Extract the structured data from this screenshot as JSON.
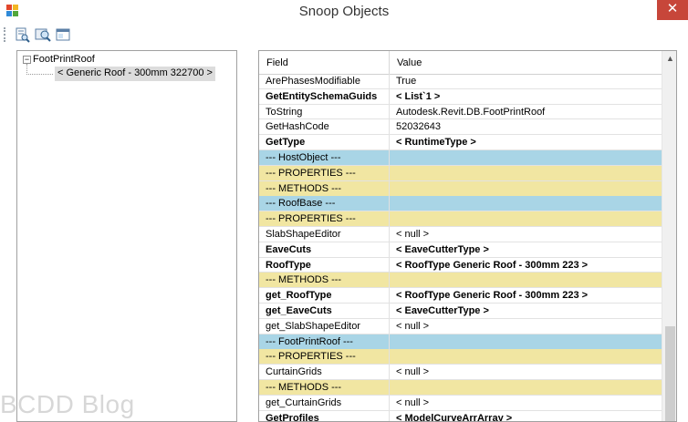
{
  "window": {
    "title": "Snoop Objects",
    "close_glyph": "✕"
  },
  "toolbar": {
    "buttons": [
      "snoop-icon",
      "find-icon",
      "window-icon"
    ]
  },
  "tree": {
    "expander_glyph": "−",
    "root_label": "FootPrintRoof",
    "child_label": "< Generic Roof - 300mm  322700 >"
  },
  "grid": {
    "columns": {
      "field": "Field",
      "value": "Value"
    },
    "rows": [
      {
        "field": "ArePhasesModifiable",
        "value": "True",
        "style": "normal"
      },
      {
        "field": "GetEntitySchemaGuids",
        "value": "< List`1 >",
        "style": "bold"
      },
      {
        "field": "ToString",
        "value": "Autodesk.Revit.DB.FootPrintRoof",
        "style": "normal"
      },
      {
        "field": "GetHashCode",
        "value": "52032643",
        "style": "normal"
      },
      {
        "field": "GetType",
        "value": "< RuntimeType >",
        "style": "bold"
      },
      {
        "field": "--- HostObject ---",
        "value": "",
        "style": "class"
      },
      {
        "field": "--- PROPERTIES ---",
        "value": "",
        "style": "section"
      },
      {
        "field": "--- METHODS ---",
        "value": "",
        "style": "section"
      },
      {
        "field": "--- RoofBase ---",
        "value": "",
        "style": "class"
      },
      {
        "field": "--- PROPERTIES ---",
        "value": "",
        "style": "section"
      },
      {
        "field": "SlabShapeEditor",
        "value": "< null >",
        "style": "normal"
      },
      {
        "field": "EaveCuts",
        "value": "< EaveCutterType >",
        "style": "bold"
      },
      {
        "field": "RoofType",
        "value": "< RoofType  Generic Roof - 300mm    223 >",
        "style": "bold"
      },
      {
        "field": "--- METHODS ---",
        "value": "",
        "style": "section"
      },
      {
        "field": "get_RoofType",
        "value": "< RoofType  Generic Roof - 300mm    223 >",
        "style": "bold"
      },
      {
        "field": "get_EaveCuts",
        "value": "< EaveCutterType >",
        "style": "bold"
      },
      {
        "field": "get_SlabShapeEditor",
        "value": "< null >",
        "style": "normal"
      },
      {
        "field": "--- FootPrintRoof ---",
        "value": "",
        "style": "class"
      },
      {
        "field": "--- PROPERTIES ---",
        "value": "",
        "style": "section"
      },
      {
        "field": "CurtainGrids",
        "value": "< null >",
        "style": "normal"
      },
      {
        "field": "--- METHODS ---",
        "value": "",
        "style": "section"
      },
      {
        "field": "get_CurtainGrids",
        "value": "< null >",
        "style": "normal"
      },
      {
        "field": "GetProfiles",
        "value": "< ModelCurveArrArray >",
        "style": "bold"
      }
    ]
  },
  "scrollbar": {
    "up_glyph": "▲",
    "position": 0.74
  },
  "watermark": "BCDD Blog",
  "colors": {
    "class_row": "#a9d5e6",
    "section_row": "#f1e6a2",
    "close_button": "#c7463a"
  }
}
